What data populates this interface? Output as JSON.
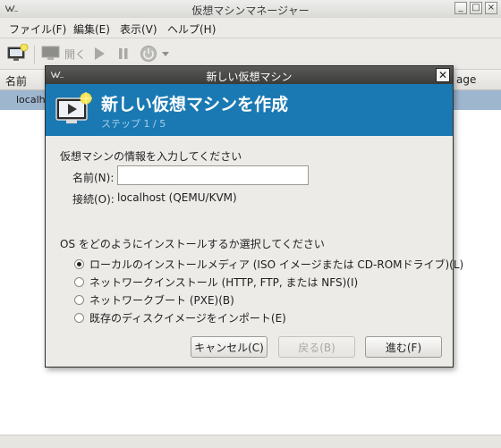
{
  "window": {
    "title": "仮想マシンマネージャー"
  },
  "menubar": [
    "ファイル(F)",
    "編集(E)",
    "表示(V)",
    "ヘルプ(H)"
  ],
  "toolbar": {
    "open_label": "開く"
  },
  "list": {
    "col_name": "名前",
    "col_usage": "age",
    "row_host": "localho"
  },
  "dialog": {
    "title": "新しい仮想マシン",
    "heading": "新しい仮想マシンを作成",
    "step": "ステップ 1 / 5",
    "info_prompt": "仮想マシンの情報を入力してください",
    "name_label": "名前(N):",
    "name_value": "",
    "connection_label": "接続(O):",
    "connection_value": "localhost (QEMU/KVM)",
    "install_prompt": "OS をどのようにインストールするか選択してください",
    "options": [
      {
        "label": "ローカルのインストールメディア (ISO イメージまたは CD-ROMドライブ)(L)",
        "selected": true
      },
      {
        "label": "ネットワークインストール (HTTP, FTP, または NFS)(I)",
        "selected": false
      },
      {
        "label": "ネットワークブート (PXE)(B)",
        "selected": false
      },
      {
        "label": "既存のディスクイメージをインポート(E)",
        "selected": false
      }
    ],
    "buttons": {
      "cancel": "キャンセル(C)",
      "back": "戻る(B)",
      "forward": "進む(F)"
    }
  },
  "colors": {
    "banner": "#1a79b2",
    "selection": "#9fb6cf",
    "dialog_titlebar": "#3c3c3a"
  }
}
